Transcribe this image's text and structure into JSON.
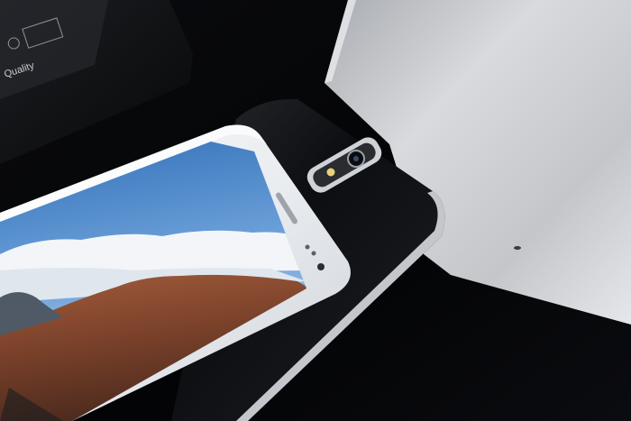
{
  "scene": {
    "subject": "smartphone-product-photo",
    "background_color": "#050608"
  },
  "box_label": {
    "text": "Quality",
    "icon": "quality-seal-icon"
  },
  "colors": {
    "phone_front": "#f1f3f6",
    "phone_back": "#141518",
    "tablet_silver": "#c6c8cc",
    "box_black": "#121316",
    "sky_top": "#2f6fb8",
    "cloud_white": "#f4f6f8",
    "hill_brown": "#8a4e33"
  }
}
